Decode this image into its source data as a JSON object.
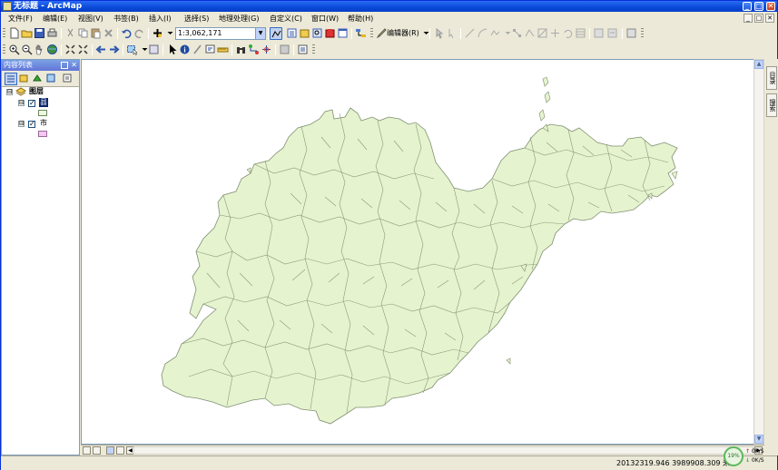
{
  "window": {
    "title": "无标题 - ArcMap",
    "buttons": {
      "minimize": "_",
      "maximize": "□",
      "close": "✕"
    }
  },
  "menu": {
    "items": [
      "文件(F)",
      "编辑(E)",
      "视图(V)",
      "书签(B)",
      "插入(I)",
      "选择(S)",
      "地理处理(G)",
      "自定义(C)",
      "窗口(W)",
      "帮助(H)"
    ],
    "mdi_buttons": [
      "_",
      "□",
      "✕"
    ]
  },
  "toolbar": {
    "scale": "1:3,062,171",
    "editor_label": "编辑器(R)"
  },
  "toc": {
    "title": "内容列表",
    "layers_group": "图层",
    "layers": [
      {
        "name": "县",
        "checked": true,
        "swatch_color": "#eef7e4",
        "selected": true
      },
      {
        "name": "市",
        "checked": true,
        "swatch_color": "#f4c8f0",
        "selected": false
      }
    ],
    "expander": "⊟"
  },
  "right_dock": {
    "tabs": [
      "目录",
      "搜索"
    ]
  },
  "map": {
    "fill_color": "#e6f3cf",
    "stroke_color": "#7f8f70"
  },
  "status": {
    "coordinates": "20132319.946  3989908.309 米"
  },
  "network": {
    "percent": "19%",
    "up": "0K/S",
    "down": "0K/S",
    "up_arrow": "↑",
    "down_arrow": "↓"
  }
}
